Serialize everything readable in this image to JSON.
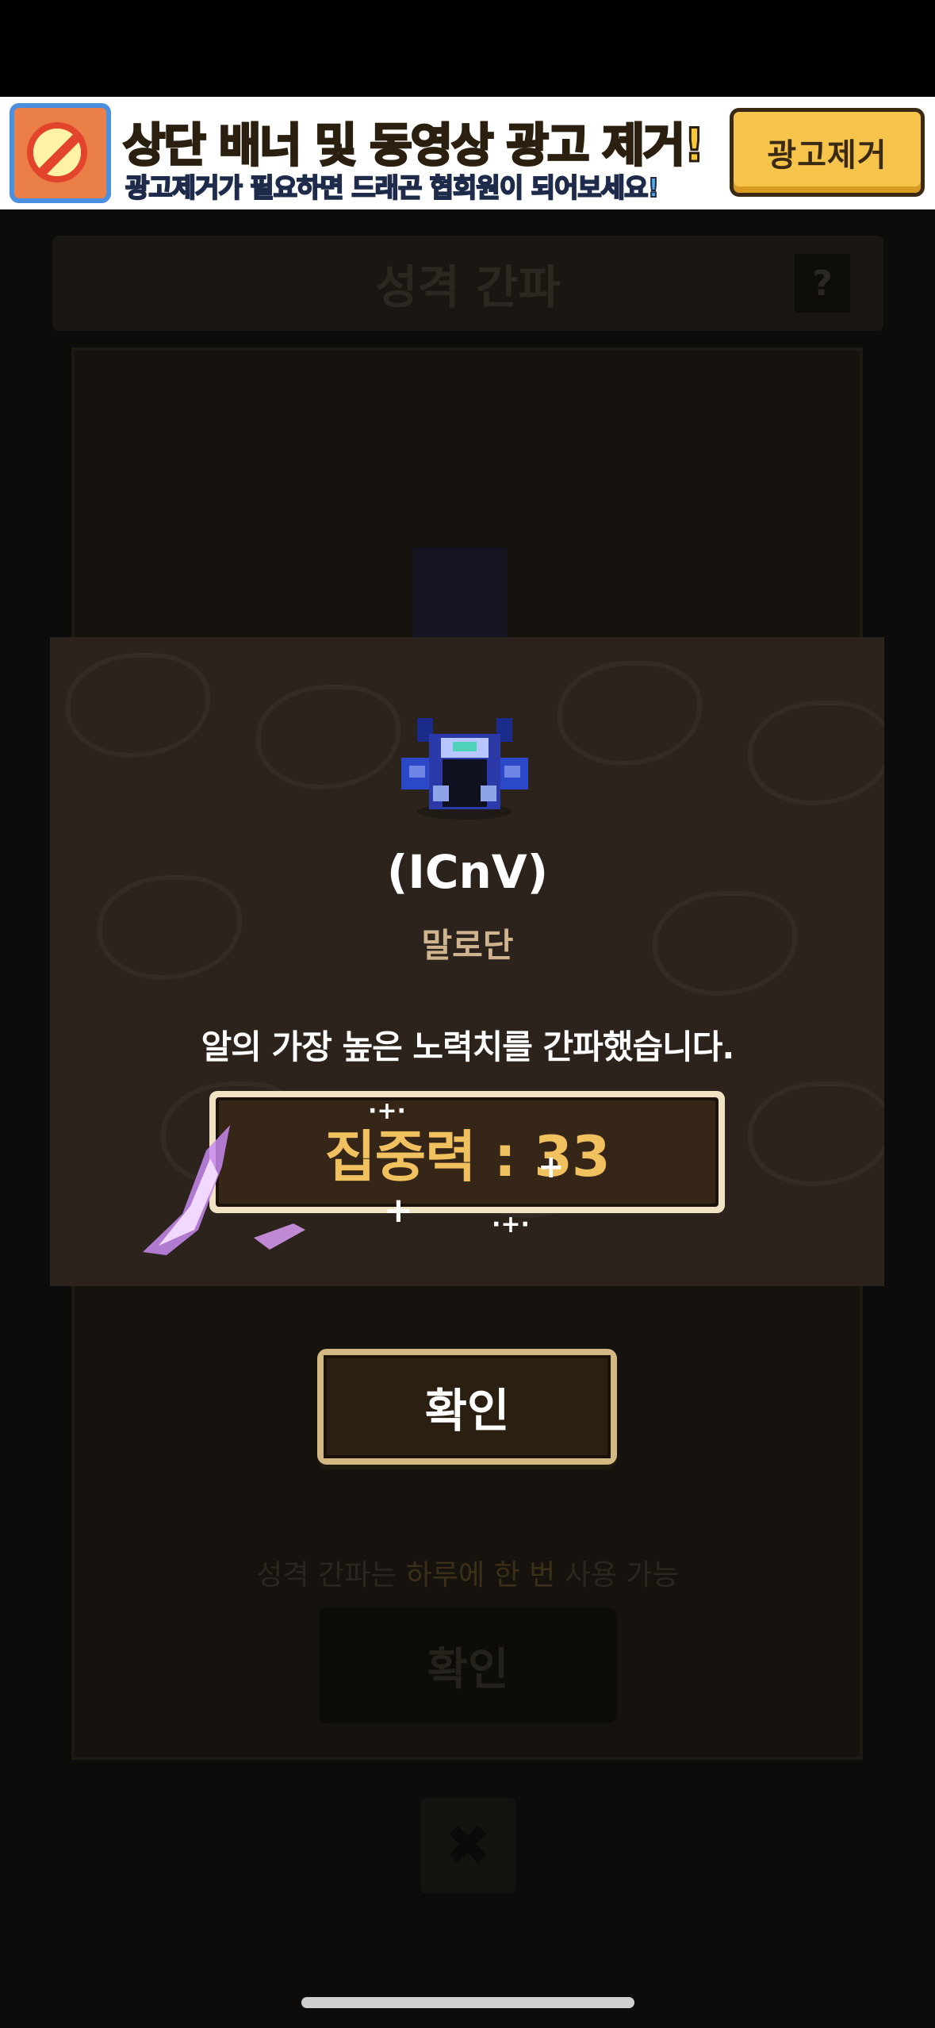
{
  "ad_banner": {
    "title": "상단 배너 및 동영상 광고 제거!",
    "subtitle": "광고제거가 필요하면 드래곤 협회원이 되어보세요!",
    "remove_button": "광고제거"
  },
  "background_screen": {
    "header_title": "성격 간파",
    "help_label": "?",
    "hint_prefix": "성격 간파는",
    "hint_highlight": "하루에 한 번",
    "hint_suffix": "사용 가능",
    "confirm_label": "확인",
    "close_label": "✖"
  },
  "result": {
    "personality_code": "(ICnV)",
    "class_name": "말로단",
    "message": "알의 가장 높은 노력치를 간파했습니다.",
    "stat_text": "집중력 : 33",
    "stat": {
      "name": "집중력",
      "value": 33
    },
    "confirm_label": "확인"
  },
  "colors": {
    "panel": "#2c241c",
    "gold_text": "#f2c15f",
    "class_text": "#cfb48f",
    "ad_button": "#f6c44b"
  }
}
